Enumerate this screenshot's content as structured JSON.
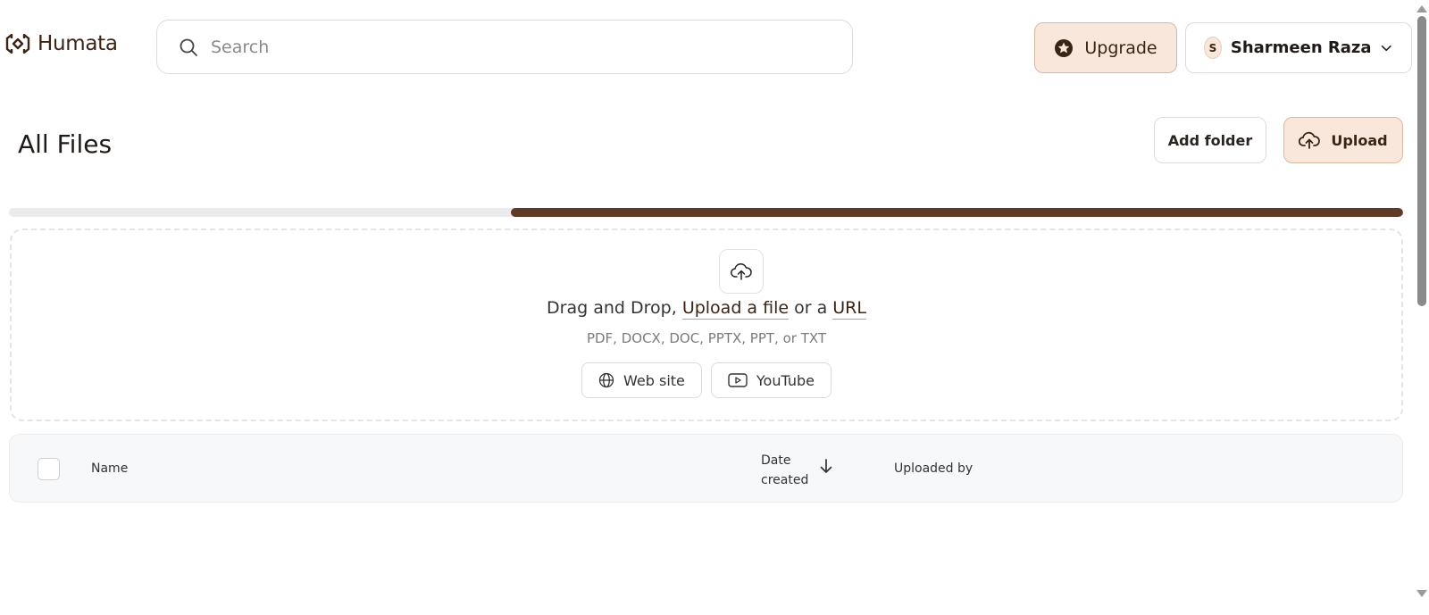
{
  "header": {
    "logo_text": "Humata",
    "search_placeholder": "Search",
    "upgrade_label": "Upgrade",
    "user": {
      "initial": "S",
      "name": "Sharmeen Raza"
    }
  },
  "main": {
    "title": "All Files",
    "add_folder_label": "Add folder",
    "upload_label": "Upload",
    "progress_percent": 64
  },
  "dropzone": {
    "text_prefix": "Drag and Drop,",
    "upload_link": "Upload a file",
    "text_mid": "or a",
    "url_link": "URL",
    "formats": "PDF, DOCX, DOC, PPTX, PPT, or TXT",
    "sources": [
      {
        "label": "Web site",
        "icon": "globe-icon"
      },
      {
        "label": "YouTube",
        "icon": "youtube-icon"
      }
    ]
  },
  "table": {
    "columns": {
      "name": "Name",
      "date_created": "Date created",
      "uploaded_by": "Uploaded by"
    },
    "sort": "date-created-descending"
  },
  "colors": {
    "accent": "#5e3b26",
    "accent_light": "#f8e7da",
    "logo": "#3b2414"
  }
}
